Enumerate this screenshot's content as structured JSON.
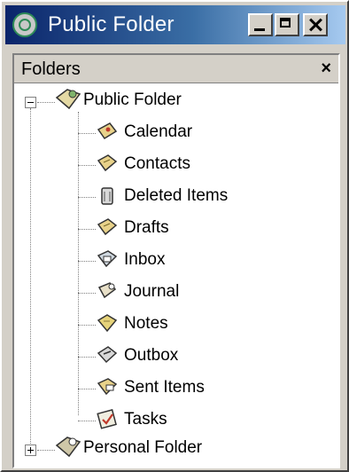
{
  "window": {
    "title": "Public Folder"
  },
  "pane": {
    "title": "Folders",
    "close_glyph": "×"
  },
  "tree": {
    "root": {
      "label": "Public Folder",
      "icon": "public-folder-icon",
      "expanded": true
    },
    "children": [
      {
        "label": "Calendar",
        "icon": "calendar-icon",
        "color": "#e8d28a"
      },
      {
        "label": "Contacts",
        "icon": "contacts-icon",
        "color": "#e8d28a"
      },
      {
        "label": "Deleted Items",
        "icon": "trash-icon",
        "color": "#d8d8d8"
      },
      {
        "label": "Drafts",
        "icon": "drafts-icon",
        "color": "#e8d28a"
      },
      {
        "label": "Inbox",
        "icon": "inbox-icon",
        "color": "#cfd8e0"
      },
      {
        "label": "Journal",
        "icon": "journal-icon",
        "color": "#e8e0c8"
      },
      {
        "label": "Notes",
        "icon": "notes-icon",
        "color": "#e6d37a"
      },
      {
        "label": "Outbox",
        "icon": "outbox-icon",
        "color": "#d8d8d8"
      },
      {
        "label": "Sent Items",
        "icon": "sent-items-icon",
        "color": "#e8d28a"
      },
      {
        "label": "Tasks",
        "icon": "tasks-icon",
        "color": "#f0eee0"
      }
    ],
    "sibling": {
      "label": "Personal Folder",
      "icon": "personal-folder-icon",
      "expanded": false
    }
  },
  "colors": {
    "titlebar_start": "#0a246a",
    "titlebar_end": "#a6caf0",
    "chrome": "#d4d0c8",
    "pane_bg": "#ffffff"
  }
}
